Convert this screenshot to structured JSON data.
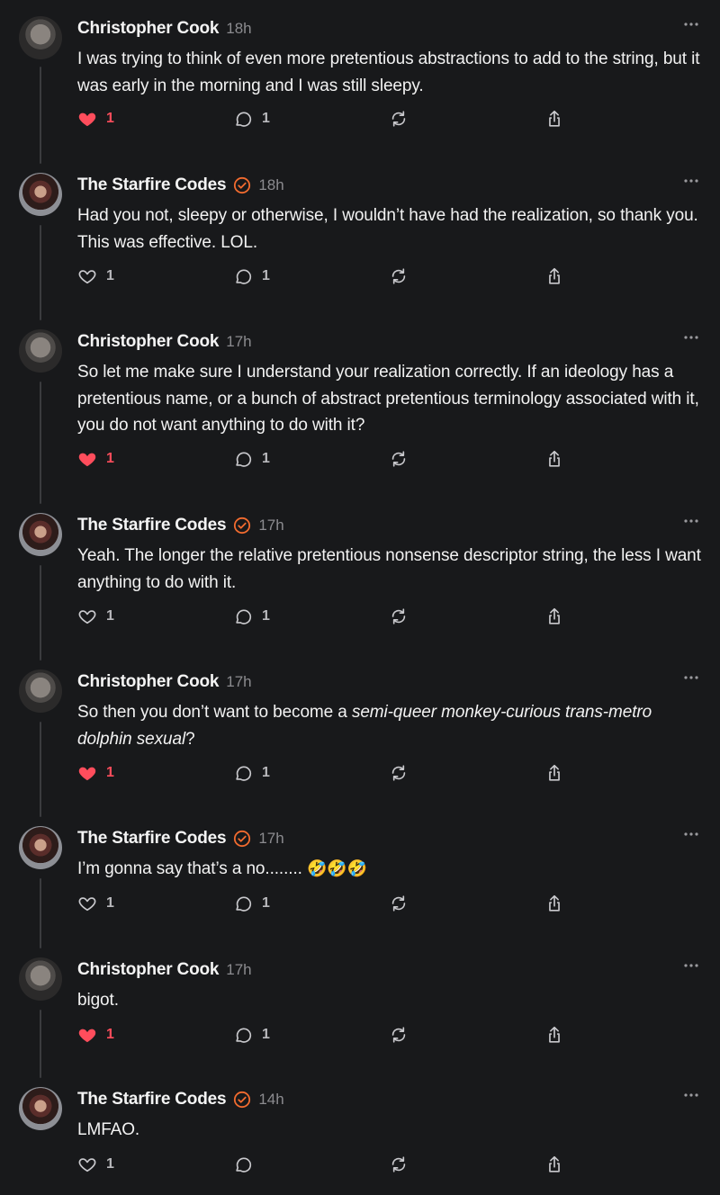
{
  "posts": [
    {
      "author": "Christopher Cook",
      "verified": false,
      "time": "18h",
      "text": "I was trying to think of even more pretentious abstractions to add to the string, but it was early in the morning and I was still sleepy.",
      "liked": true,
      "likes": "1",
      "replies": "1"
    },
    {
      "author": "The Starfire Codes",
      "verified": true,
      "time": "18h",
      "text": "Had you not, sleepy or otherwise, I wouldn’t have had the realization, so thank you. This was effective. LOL.",
      "liked": false,
      "likes": "1",
      "replies": "1"
    },
    {
      "author": "Christopher Cook",
      "verified": false,
      "time": "17h",
      "text": "So let me make sure I understand your realization correctly. If an ideology has a pretentious name, or a bunch of abstract pretentious terminology associated with it, you do not want anything to do with it?",
      "liked": true,
      "likes": "1",
      "replies": "1"
    },
    {
      "author": "The Starfire Codes",
      "verified": true,
      "time": "17h",
      "text": "Yeah. The longer the relative pretentious nonsense descriptor string, the less I want anything to do with it.",
      "liked": false,
      "likes": "1",
      "replies": "1"
    },
    {
      "author": "Christopher Cook",
      "verified": false,
      "time": "17h",
      "text_prefix": "So then you don’t want to become a ",
      "text_italic": "semi-queer monkey-curious trans-metro dolphin sexual",
      "text_suffix": "?",
      "liked": true,
      "likes": "1",
      "replies": "1"
    },
    {
      "author": "The Starfire Codes",
      "verified": true,
      "time": "17h",
      "text": "I’m gonna say that’s a no........ ",
      "text_emoji": "🤣🤣🤣",
      "liked": false,
      "likes": "1",
      "replies": "1"
    },
    {
      "author": "Christopher Cook",
      "verified": false,
      "time": "17h",
      "text": "bigot.",
      "liked": true,
      "likes": "1",
      "replies": "1"
    },
    {
      "author": "The Starfire Codes",
      "verified": true,
      "time": "14h",
      "text": "LMFAO.",
      "liked": false,
      "likes": "1",
      "replies": ""
    }
  ],
  "icons": {
    "like": "heart-icon",
    "reply": "comment-icon",
    "repost": "repost-icon",
    "share": "share-icon",
    "more": "more-icon",
    "verified": "verified-badge-icon"
  },
  "colors": {
    "background": "#18191b",
    "liked": "#ff4d5c",
    "verified": "#f26b2f",
    "muted": "#8b8b8f"
  }
}
